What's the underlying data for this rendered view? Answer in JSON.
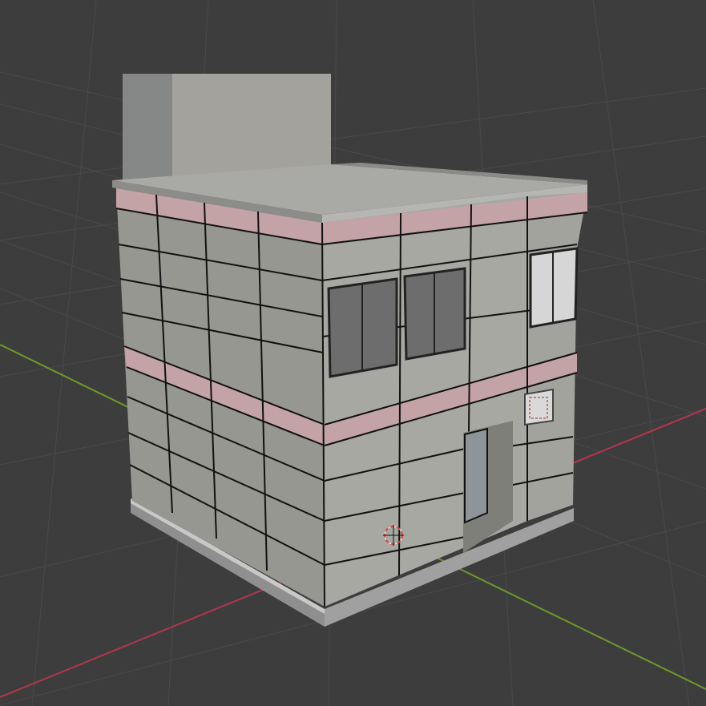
{
  "viewport": {
    "mode": "3d-viewport",
    "background_color": "#3d3d3d",
    "grid_color": "#4a4a4a",
    "x_axis_color": "#b3374a",
    "y_axis_color": "#6c9a2a"
  },
  "scene": {
    "object": "building",
    "colors": {
      "wall_light": "#a8a8a2",
      "wall_shade": "#979792",
      "roof": "#a9a9a6",
      "rooftop_unit_front": "#a4a29d",
      "rooftop_unit_side": "#868888",
      "pink_band": "#c4a3a6",
      "window_glass": "#6d6d6d",
      "window_glass_bright": "#d6d6d6",
      "sign_border": "#c07b7b",
      "cursor_red": "#d8413c"
    },
    "icons": [
      "3d-cursor-icon"
    ]
  }
}
